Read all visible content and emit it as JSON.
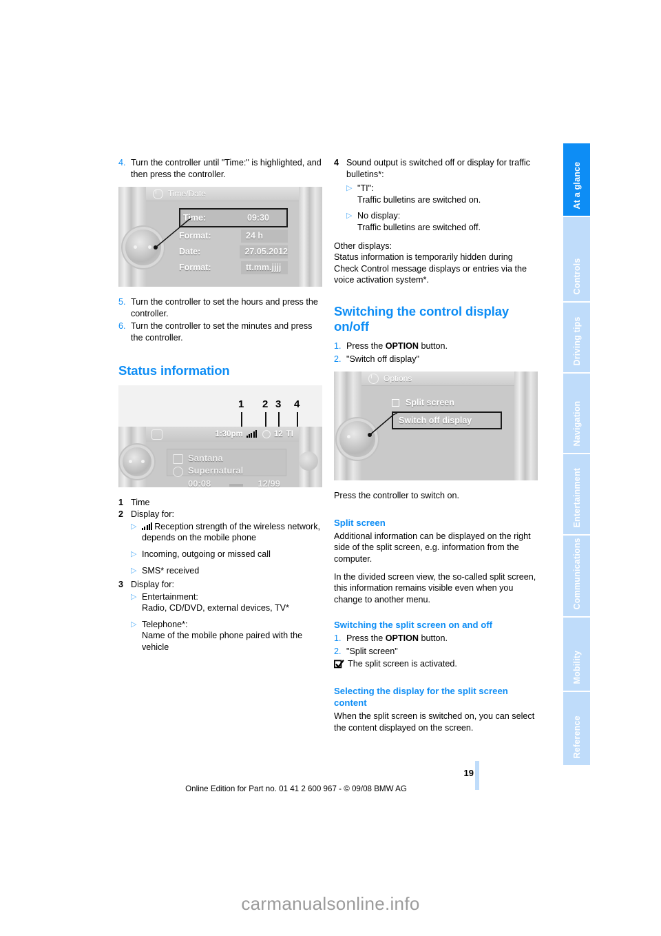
{
  "sidebar": {
    "tabs": [
      {
        "label": "At a glance",
        "active": true
      },
      {
        "label": "Controls",
        "active": false
      },
      {
        "label": "Driving tips",
        "active": false
      },
      {
        "label": "Navigation",
        "active": false
      },
      {
        "label": "Entertainment",
        "active": false
      },
      {
        "label": "Communications",
        "active": false
      },
      {
        "label": "Mobility",
        "active": false
      },
      {
        "label": "Reference",
        "active": false
      }
    ],
    "active_color": "#0d8df5",
    "inactive_color": "#bfdcfa"
  },
  "left_column": {
    "step4": {
      "num": "4.",
      "text": "Turn the controller until \"Time:\" is highlighted, and then press the controller."
    },
    "time_date_shot": {
      "title": "Time/Date",
      "rows": [
        {
          "label": "Time:",
          "value": "09:30",
          "selected": true
        },
        {
          "label": "Format:",
          "value": "24 h",
          "selected": false
        },
        {
          "label": "Date:",
          "value": "27.05.2012",
          "selected": false
        },
        {
          "label": "Format:",
          "value": "tt.mm.jjjj",
          "selected": false
        }
      ]
    },
    "step5": {
      "num": "5.",
      "text": "Turn the controller to set the hours and press the controller."
    },
    "step6": {
      "num": "6.",
      "text": "Turn the controller to set the minutes and press the controller."
    },
    "status_heading": "Status information",
    "status_shot": {
      "callouts": [
        "1",
        "2",
        "3",
        "4"
      ],
      "time": "1:30pm",
      "temp": "12",
      "ti": "TI",
      "artist": "Santana",
      "album": "Supernatural",
      "elapsed": "00:08",
      "track": "12/99"
    },
    "legend": [
      {
        "num": "1",
        "text": "Time",
        "bullets": []
      },
      {
        "num": "2",
        "text": "Display for:",
        "bullets": [
          {
            "icon": "signal-bars-icon",
            "text": "Reception strength of the wireless network, depends on the mobile phone"
          },
          {
            "icon": "",
            "text": "Incoming, outgoing or missed call"
          },
          {
            "icon": "",
            "text": "SMS* received"
          }
        ]
      },
      {
        "num": "3",
        "text": "Display for:",
        "bullets": [
          {
            "icon": "",
            "text": "Entertainment:\nRadio, CD/DVD, external devices, TV*"
          },
          {
            "icon": "",
            "text": "Telephone*:\nName of the mobile phone paired with the vehicle"
          }
        ]
      }
    ]
  },
  "right_column": {
    "legend4": {
      "num": "4",
      "text": "Sound output is switched off or display for traffic bulletins*:",
      "bullets": [
        {
          "text": "\"TI\":\nTraffic bulletins are switched on."
        },
        {
          "text": "No display:\nTraffic bulletins are switched off."
        }
      ]
    },
    "other_displays": "Other displays:\nStatus information is temporarily hidden during Check Control message displays or entries via the voice activation system*.",
    "heading_switching_control_display": "Switching the control display on/off",
    "steps_control_display": [
      {
        "num": "1.",
        "text": "Press the ",
        "bold": "OPTION",
        "tail": " button."
      },
      {
        "num": "2.",
        "text": "\"Switch off display\""
      }
    ],
    "options_shot": {
      "title": "Options",
      "rows": [
        {
          "label": "Split screen",
          "checkbox": true,
          "selected": false
        },
        {
          "label": "Switch off display",
          "checkbox": false,
          "selected": true
        }
      ]
    },
    "press_controller": "Press the controller to switch on.",
    "heading_split_screen": "Split screen",
    "split_screen_p1": "Additional information can be displayed on the right side of the split screen, e.g. information from the computer.",
    "split_screen_p2": "In the divided screen view, the so-called split screen, this information remains visible even when you change to another menu.",
    "heading_switching_split": "Switching the split screen on and off",
    "steps_split": [
      {
        "num": "1.",
        "text": "Press the ",
        "bold": "OPTION",
        "tail": " button."
      },
      {
        "num": "2.",
        "text": "\"Split screen\""
      }
    ],
    "split_result": "The split screen is activated.",
    "heading_selecting_display": "Selecting the display for the split screen content",
    "selecting_body": "When the split screen is switched on, you can select the content displayed on the screen."
  },
  "footer": {
    "page_number": "19",
    "edition": "Online Edition for Part no. 01 41 2 600 967  - © 09/08 BMW AG"
  },
  "watermark": "carmanualsonline.info"
}
